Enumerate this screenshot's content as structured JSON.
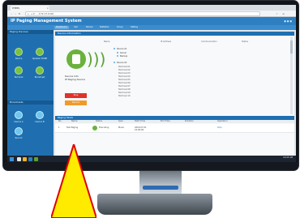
{
  "browser": {
    "tab_title": "ITPMS",
    "url": "← → C  ··· 172.17.0.60"
  },
  "app": {
    "title": "IP Paging Management System",
    "toolbar": [
      "Dashboard",
      "Call",
      "Device",
      "Statistics",
      "Group",
      "Setting"
    ]
  },
  "sidebar": {
    "section1": "Paging Devices",
    "items1": [
      {
        "label": "Device",
        "icon": "device-icon"
      },
      {
        "label": "Speaker ZONE",
        "icon": "speaker-icon"
      },
      {
        "label": "Terminal",
        "icon": "terminal-icon"
      },
      {
        "label": "Broadcast",
        "icon": "broadcast-icon"
      }
    ],
    "section2": "Broadcasts",
    "items2": [
      {
        "label": "Device A"
      },
      {
        "label": "Device B"
      },
      {
        "label": "Record"
      }
    ]
  },
  "main": {
    "panel_title": "Device Information",
    "columns": [
      "Name",
      "IP Address",
      "Communication",
      "Status"
    ],
    "device_label": "Device Info",
    "device_sub": "IP Paging Device",
    "btn_red": "Stop",
    "btn_orange": "Record",
    "tree": [
      "Device 01",
      "Server",
      "Backup",
      "Device 02"
    ],
    "rows": [
      "Terminal 01",
      "Terminal 02",
      "Terminal 03",
      "Terminal 04",
      "Terminal 05",
      "Terminal 06",
      "Terminal 07",
      "Terminal 08",
      "Terminal 09",
      "Terminal 10"
    ],
    "lower_title": "Paging Tasks",
    "lower_columns": [
      "No.",
      "Name",
      "Status",
      "Type",
      "Start Time",
      "End Time",
      "Duration",
      "Operation"
    ],
    "lower_row": {
      "name": "Test Paging",
      "status": "Executing",
      "type": "Music",
      "time": "2019-07-01 10:00:00",
      "op": "Stop"
    }
  },
  "taskbar": {
    "time": "10:45 AM"
  },
  "colors": {
    "header": "#2d7fc1",
    "accent_green": "#6ab23c",
    "annotation": "#ffeb00"
  }
}
